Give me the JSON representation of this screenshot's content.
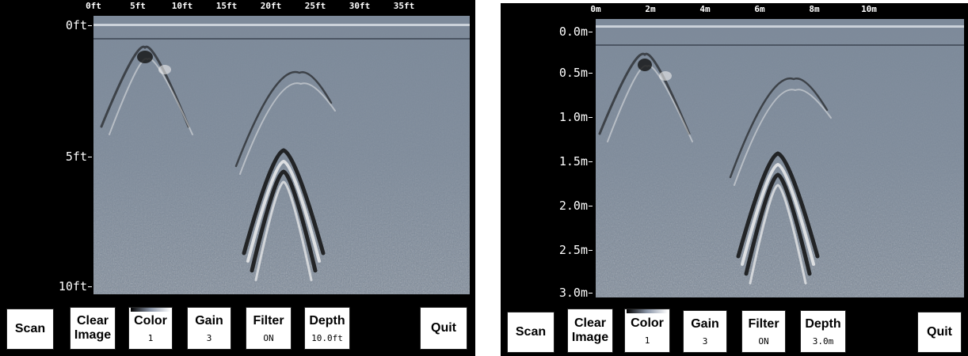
{
  "left": {
    "x_ticks": [
      "0ft",
      "5ft",
      "10ft",
      "15ft",
      "20ft",
      "25ft",
      "30ft",
      "35ft"
    ],
    "y_ticks": [
      "0ft",
      "5ft",
      "10ft"
    ],
    "toolbar": {
      "scan": "Scan",
      "clear": [
        "Clear",
        "Image"
      ],
      "color": {
        "label": "Color",
        "value": "1"
      },
      "gain": {
        "label": "Gain",
        "value": "3"
      },
      "filter": {
        "label": "Filter",
        "value": "ON"
      },
      "depth": {
        "label": "Depth",
        "value": "10.0ft"
      },
      "quit": "Quit"
    }
  },
  "right": {
    "x_ticks": [
      "0m",
      "2m",
      "4m",
      "6m",
      "8m",
      "10m"
    ],
    "y_ticks": [
      "0.0m",
      "0.5m",
      "1.0m",
      "1.5m",
      "2.0m",
      "2.5m",
      "3.0m"
    ],
    "toolbar": {
      "scan": "Scan",
      "clear": [
        "Clear",
        "Image"
      ],
      "color": {
        "label": "Color",
        "value": "1"
      },
      "gain": {
        "label": "Gain",
        "value": "3"
      },
      "filter": {
        "label": "Filter",
        "value": "ON"
      },
      "depth": {
        "label": "Depth",
        "value": "3.0m"
      },
      "quit": "Quit"
    }
  },
  "colors": {
    "panel_bg": "#000000",
    "radar_bg": "#7d8a9a",
    "button_bg": "#ffffff"
  }
}
